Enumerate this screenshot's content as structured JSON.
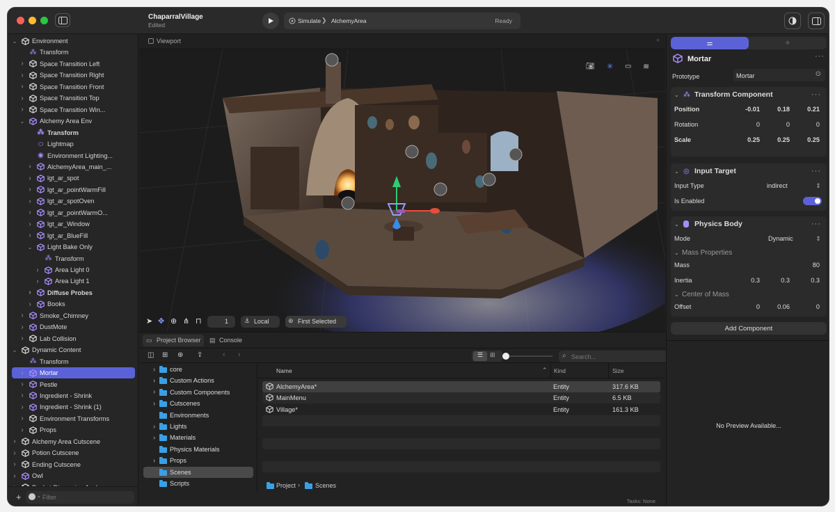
{
  "titlebar": {
    "project": "ChaparralVillage",
    "status": "Edited",
    "scheme": "Simulate",
    "target": "AlchemyArea",
    "state": "Ready"
  },
  "sidebar": {
    "items": [
      {
        "label": "Environment",
        "depth": 1,
        "chev": "v",
        "icon": "entity"
      },
      {
        "label": "Transform",
        "depth": 2,
        "chev": "",
        "icon": "transform"
      },
      {
        "label": "Space Transition Left",
        "depth": 2,
        "chev": ">",
        "icon": "entity"
      },
      {
        "label": "Space Transition Right",
        "depth": 2,
        "chev": ">",
        "icon": "entity"
      },
      {
        "label": "Space Transition Front",
        "depth": 2,
        "chev": ">",
        "icon": "entity"
      },
      {
        "label": "Space Transition Top",
        "depth": 2,
        "chev": ">",
        "icon": "entity"
      },
      {
        "label": "Space Transition Win...",
        "depth": 2,
        "chev": ">",
        "icon": "entity"
      },
      {
        "label": "Alchemy Area Env",
        "depth": 2,
        "chev": "v",
        "icon": "entity-purple"
      },
      {
        "label": "Transform",
        "depth": 3,
        "chev": "",
        "icon": "transform",
        "bold": true
      },
      {
        "label": "Lightmap",
        "depth": 3,
        "chev": "",
        "icon": "lightmap"
      },
      {
        "label": "Environment Lighting...",
        "depth": 3,
        "chev": "",
        "icon": "env"
      },
      {
        "label": "AlchemyArea_main_...",
        "depth": 3,
        "chev": ">",
        "icon": "entity-purple"
      },
      {
        "label": "lgt_ar_spot",
        "depth": 3,
        "chev": ">",
        "icon": "entity-purple"
      },
      {
        "label": "lgt_ar_pointWarmFill",
        "depth": 3,
        "chev": ">",
        "icon": "entity-purple"
      },
      {
        "label": "lgt_ar_spotOven",
        "depth": 3,
        "chev": ">",
        "icon": "entity-purple"
      },
      {
        "label": "lgt_ar_pointWarmO...",
        "depth": 3,
        "chev": ">",
        "icon": "entity-purple"
      },
      {
        "label": "lgt_ar_Window",
        "depth": 3,
        "chev": ">",
        "icon": "entity-purple"
      },
      {
        "label": "lgt_ar_BlueFill",
        "depth": 3,
        "chev": ">",
        "icon": "entity-purple"
      },
      {
        "label": "Light Bake Only",
        "depth": 3,
        "chev": "v",
        "icon": "entity-purple"
      },
      {
        "label": "Transform",
        "depth": 4,
        "chev": "",
        "icon": "transform"
      },
      {
        "label": "Area Light 0",
        "depth": 4,
        "chev": ">",
        "icon": "entity-purple"
      },
      {
        "label": "Area Light 1",
        "depth": 4,
        "chev": ">",
        "icon": "entity-purple"
      },
      {
        "label": "Diffuse Probes",
        "depth": 3,
        "chev": ">",
        "icon": "entity-purple",
        "bold": true
      },
      {
        "label": "Books",
        "depth": 3,
        "chev": ">",
        "icon": "entity-purple"
      },
      {
        "label": "Smoke_Chimney",
        "depth": 2,
        "chev": ">",
        "icon": "entity-purple"
      },
      {
        "label": "DustMote",
        "depth": 2,
        "chev": ">",
        "icon": "entity-purple"
      },
      {
        "label": "Lab Collision",
        "depth": 2,
        "chev": ">",
        "icon": "entity"
      },
      {
        "label": "Dynamic Content",
        "depth": 1,
        "chev": "v",
        "icon": "entity"
      },
      {
        "label": "Transform",
        "depth": 2,
        "chev": "",
        "icon": "transform"
      },
      {
        "label": "Mortar",
        "depth": 2,
        "chev": ">",
        "icon": "entity-purple",
        "selected": true
      },
      {
        "label": "Pestle",
        "depth": 2,
        "chev": ">",
        "icon": "entity-purple"
      },
      {
        "label": "Ingredient - Shrink",
        "depth": 2,
        "chev": ">",
        "icon": "entity-purple"
      },
      {
        "label": "Ingredient - Shrink (1)",
        "depth": 2,
        "chev": ">",
        "icon": "entity-purple"
      },
      {
        "label": "Environment Transforms",
        "depth": 2,
        "chev": ">",
        "icon": "entity"
      },
      {
        "label": "Props",
        "depth": 2,
        "chev": ">",
        "icon": "entity"
      },
      {
        "label": "Alchemy Area Cutscene",
        "depth": 1,
        "chev": ">",
        "icon": "entity"
      },
      {
        "label": "Potion Cutscene",
        "depth": 1,
        "chev": ">",
        "icon": "entity"
      },
      {
        "label": "Ending Cutscene",
        "depth": 1,
        "chev": ">",
        "icon": "entity"
      },
      {
        "label": "Owl",
        "depth": 1,
        "chev": ">",
        "icon": "entity-purple"
      },
      {
        "label": "Pocket Dimension Anchor",
        "depth": 1,
        "chev": ">",
        "icon": "entity"
      }
    ],
    "filter_placeholder": "Filter"
  },
  "viewport": {
    "label": "Viewport",
    "count": "1",
    "space": "Local",
    "pivot": "First Selected"
  },
  "bottom": {
    "tabs": [
      "Project Browser",
      "Console"
    ],
    "search_placeholder": "Search...",
    "folders": [
      {
        "label": "core",
        "chev": true
      },
      {
        "label": "Custom Actions",
        "chev": true
      },
      {
        "label": "Custom Components",
        "chev": true
      },
      {
        "label": "Cutscenes",
        "chev": true
      },
      {
        "label": "Environments",
        "chev": false
      },
      {
        "label": "Lights",
        "chev": true
      },
      {
        "label": "Materials",
        "chev": true
      },
      {
        "label": "Physics Materials",
        "chev": false
      },
      {
        "label": "Props",
        "chev": true
      },
      {
        "label": "Scenes",
        "chev": false,
        "selected": true
      },
      {
        "label": "Scripts",
        "chev": false
      }
    ],
    "columns": {
      "name": "Name",
      "kind": "Kind",
      "size": "Size"
    },
    "files": [
      {
        "name": "AlchemyArea*",
        "kind": "Entity",
        "size": "317.6 KB",
        "selected": true
      },
      {
        "name": "MainMenu",
        "kind": "Entity",
        "size": "6.5 KB"
      },
      {
        "name": "Village*",
        "kind": "Entity",
        "size": "161.3 KB"
      }
    ],
    "path": [
      "Project",
      "Scenes"
    ],
    "tasks": "Tasks: None"
  },
  "inspector": {
    "entity": "Mortar",
    "prototype_label": "Prototype",
    "prototype_value": "Mortar",
    "transform": {
      "title": "Transform Component",
      "position_label": "Position",
      "position": [
        "-0.01",
        "0.18",
        "0.21"
      ],
      "rotation_label": "Rotation",
      "rotation": [
        "0",
        "0",
        "0"
      ],
      "scale_label": "Scale",
      "scale": [
        "0.25",
        "0.25",
        "0.25"
      ]
    },
    "input": {
      "title": "Input Target",
      "type_label": "Input Type",
      "type_value": "indirect",
      "enabled_label": "Is Enabled",
      "enabled": true
    },
    "physics": {
      "title": "Physics Body",
      "mode_label": "Mode",
      "mode_value": "Dynamic",
      "mass_props": "Mass Properties",
      "mass_label": "Mass",
      "mass": "80",
      "inertia_label": "Inertia",
      "inertia": [
        "0.3",
        "0.3",
        "0.3"
      ],
      "com": "Center of Mass",
      "offset_label": "Offset",
      "offset": [
        "0",
        "0.06",
        "0"
      ]
    },
    "add_component": "Add Component",
    "preview": "No Preview Available..."
  },
  "colors": {
    "accent": "#5b62d8",
    "purple": "#a78bfa",
    "folder": "#3aa0e6"
  }
}
